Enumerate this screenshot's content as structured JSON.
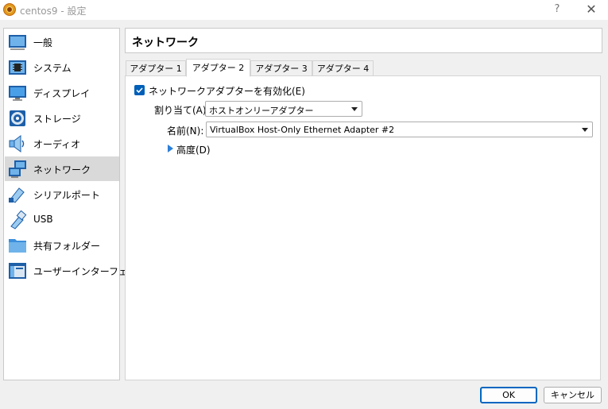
{
  "window": {
    "title": "centos9 - 設定",
    "help_label": "?",
    "close_label": "✕"
  },
  "sidebar": {
    "items": [
      {
        "label": "一般",
        "icon": "general-icon"
      },
      {
        "label": "システム",
        "icon": "system-chip-icon"
      },
      {
        "label": "ディスプレイ",
        "icon": "display-monitor-icon"
      },
      {
        "label": "ストレージ",
        "icon": "storage-disk-icon"
      },
      {
        "label": "オーディオ",
        "icon": "audio-speaker-icon"
      },
      {
        "label": "ネットワーク",
        "icon": "network-icon",
        "selected": true
      },
      {
        "label": "シリアルポート",
        "icon": "serial-port-icon"
      },
      {
        "label": "USB",
        "icon": "usb-icon"
      },
      {
        "label": "共有フォルダー",
        "icon": "shared-folder-icon"
      },
      {
        "label": "ユーザーインターフェース",
        "icon": "user-interface-icon"
      }
    ]
  },
  "main": {
    "title": "ネットワーク",
    "tabs": [
      {
        "label": "アダプター 1"
      },
      {
        "label": "アダプター 2",
        "active": true
      },
      {
        "label": "アダプター 3"
      },
      {
        "label": "アダプター 4"
      }
    ],
    "enable_checkbox": {
      "label": "ネットワークアダプターを有効化(E)",
      "checked": true
    },
    "attached_to": {
      "label": "割り当て(A):",
      "value": "ホストオンリーアダプター"
    },
    "name": {
      "label": "名前(N):",
      "value": "VirtualBox Host-Only Ethernet Adapter #2"
    },
    "advanced_label": "高度(D)"
  },
  "buttons": {
    "ok_label": "OK",
    "cancel_label": "キャンセル"
  },
  "colors": {
    "accent": "#0067c0",
    "checkbox": "#005fb8",
    "selection": "#d9d9d9"
  }
}
